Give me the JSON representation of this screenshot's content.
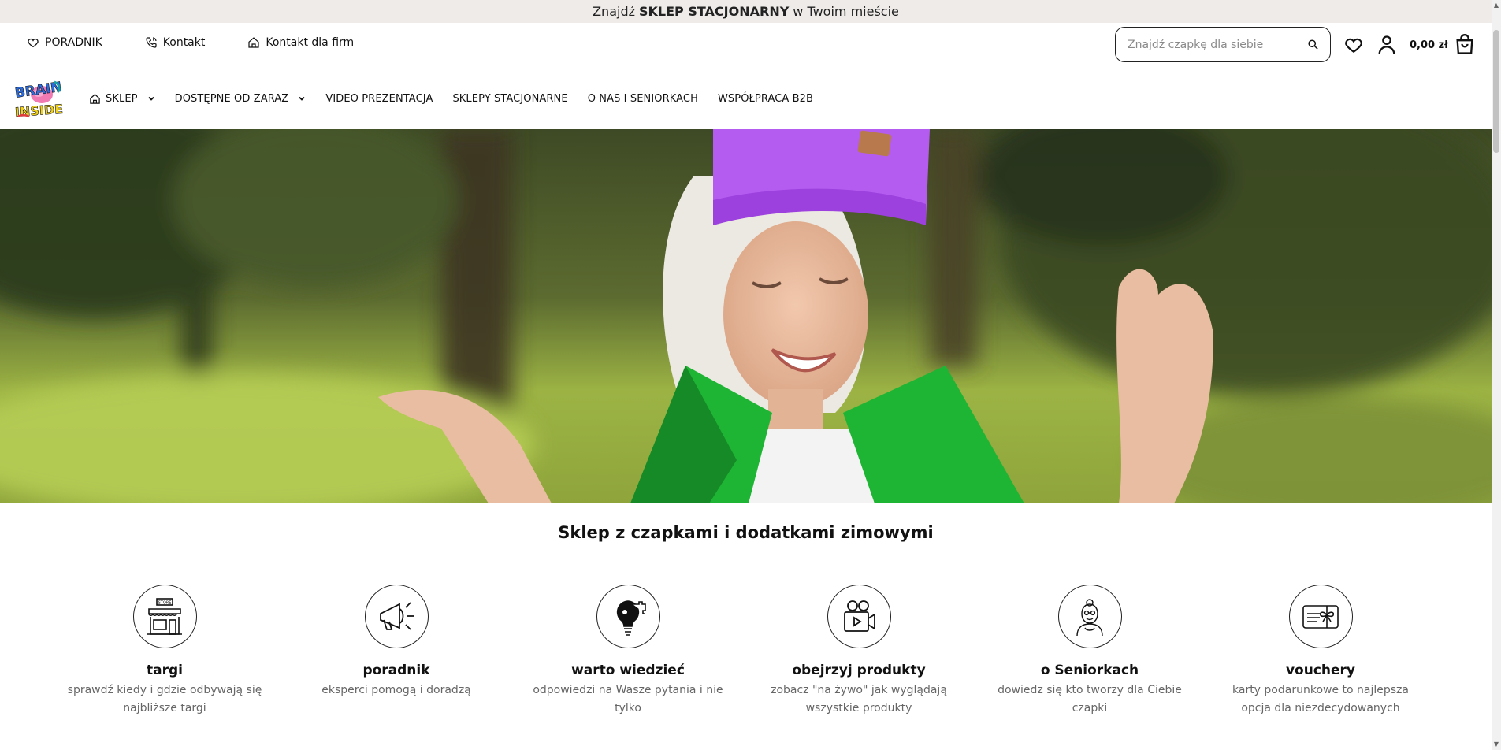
{
  "announcement": {
    "prefix": "Znajdź",
    "highlight": "SKLEP STACJONARNY",
    "suffix": "w Twoim mieście"
  },
  "util_links": [
    {
      "label": "PORADNIK",
      "icon": "heart-icon"
    },
    {
      "label": "Kontakt",
      "icon": "phone-icon"
    },
    {
      "label": "Kontakt dla firm",
      "icon": "building-icon"
    }
  ],
  "search": {
    "placeholder": "Znajdź czapkę dla siebie"
  },
  "cart": {
    "amount": "0,00 zł"
  },
  "nav": [
    {
      "label": "SKLEP",
      "icon": "home-icon",
      "dropdown": true
    },
    {
      "label": "DOSTĘPNE OD ZARAZ",
      "dropdown": true
    },
    {
      "label": "VIDEO PREZENTACJA"
    },
    {
      "label": "SKLEPY STACJONARNE"
    },
    {
      "label": "O NAS I SENIORKACH"
    },
    {
      "label": "WSPÓŁPRACA B2B"
    }
  ],
  "brand": {
    "logo_text_1": "BRAIN",
    "logo_text_2": "INSIDE"
  },
  "section_title": "Sklep z czapkami i dodatkami zimowymi",
  "features": [
    {
      "title": "targi",
      "desc": "sprawdź kiedy i gdzie odbywają się najbliższe targi",
      "icon": "store-icon",
      "sign": "STORE"
    },
    {
      "title": "poradnik",
      "desc": "eksperci pomogą i doradzą",
      "icon": "megaphone-icon"
    },
    {
      "title": "warto wiedzieć",
      "desc": "odpowiedzi na Wasze pytania i nie tylko",
      "icon": "lightbulb-puzzle-icon"
    },
    {
      "title": "obejrzyj produkty",
      "desc": "zobacz \"na żywo\" jak wyglądają wszystkie produkty",
      "icon": "video-camera-icon"
    },
    {
      "title": "o Seniorkach",
      "desc": "dowiedz się kto tworzy dla Ciebie czapki",
      "icon": "grandma-icon"
    },
    {
      "title": "vouchery",
      "desc": "karty podarunkowe to najlepsza opcja dla niezdecydowanych",
      "icon": "gift-card-icon"
    }
  ],
  "colors": {
    "announcement_bg": "#efebe8",
    "text": "#111111",
    "muted": "#666666",
    "hat": "#b45cf0",
    "jacket": "#1fb534"
  }
}
